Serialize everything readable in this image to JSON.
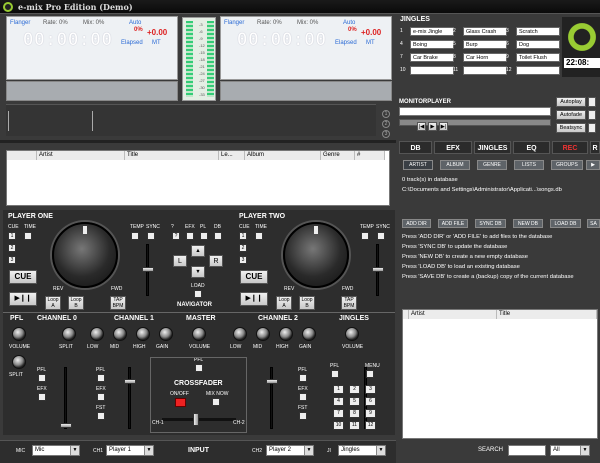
{
  "window": {
    "title": "e-mix Pro Edition (Demo)"
  },
  "deck1": {
    "flanger": "Flanger",
    "flanger_val": "Rate: 0%",
    "mix": "Mix: 0%",
    "auto": "Auto",
    "pitch": "+0.00",
    "bpm_pct": "0%",
    "elapsed": "Elapsed",
    "mt": "MT",
    "time": "00:00:00"
  },
  "deck2": {
    "flanger": "Flanger",
    "flanger_val": "Rate: 0%",
    "mix": "Mix: 0%",
    "auto": "Auto",
    "pitch": "+0.00",
    "bpm_pct": "0%",
    "elapsed": "Elapsed",
    "mt": "MT",
    "time": "00:00:00"
  },
  "meter": {
    "scale": [
      "-3",
      "-6",
      "-9",
      "-12",
      "-15",
      "-18",
      "-21",
      "-24",
      "-27",
      "-30",
      "-33"
    ]
  },
  "jingles": {
    "title": "JINGLES",
    "items": [
      {
        "n": "1",
        "label": "e-mix Jingle"
      },
      {
        "n": "2",
        "label": "Glass Crash"
      },
      {
        "n": "3",
        "label": "Scratch"
      },
      {
        "n": "4",
        "label": "Boing"
      },
      {
        "n": "5",
        "label": "Burp"
      },
      {
        "n": "6",
        "label": "Dog"
      },
      {
        "n": "7",
        "label": "Car Brake"
      },
      {
        "n": "8",
        "label": "Car Horn"
      },
      {
        "n": "9",
        "label": "Toilet Flush"
      },
      {
        "n": "10",
        "label": ""
      },
      {
        "n": "11",
        "label": ""
      },
      {
        "n": "12",
        "label": ""
      }
    ]
  },
  "clock": "22:08:",
  "monitor": {
    "title": "MONITORPLAYER"
  },
  "auto": {
    "autoplay": "Autoplay",
    "autofade": "Autofade",
    "beatsync": "Beatsync"
  },
  "playlist": {
    "columns": [
      "",
      "Artist",
      "Title",
      "Le...",
      "Album",
      "Genre",
      "#"
    ]
  },
  "tabs": {
    "db": "DB",
    "efx": "EFX",
    "jingles": "JINGLES",
    "eq": "EQ",
    "rec": "REC",
    "more": "R"
  },
  "db_buttons": {
    "artist": "ARTIST",
    "album": "ALBUM",
    "genre": "GENRE",
    "lists": "LISTS",
    "groups": "GROUPS"
  },
  "db_info": {
    "count": "0 track(s) in database",
    "path": "C:\\Documents and Settings\\Administrator\\Applicati...\\songs.db"
  },
  "db_actions": {
    "add_dir": "ADD DIR",
    "add_file": "ADD FILE",
    "sync_db": "SYNC DB",
    "new_db": "NEW DB",
    "load_db": "LOAD DB",
    "save": "SA"
  },
  "db_help": [
    "Press 'ADD DIR' or 'ADD FILE' to add files to the database",
    "Press 'SYNC DB' to update the database",
    "Press 'NEW DB' to create a new empty database",
    "Press 'LOAD DB' to load an existing database",
    "Press 'SAVE DB' to create a (backup) copy of the current database"
  ],
  "results": {
    "columns": [
      "Artist",
      "Title"
    ]
  },
  "search": {
    "label": "SEARCH",
    "value": "",
    "filter": "All"
  },
  "player_one": {
    "title": "PLAYER ONE",
    "cue": "CUE",
    "time": "TIME",
    "temp": "TEMP",
    "sync": "SYNC",
    "rev": "REV",
    "fwd": "FWD",
    "loop_a": "Loop A",
    "loop_b": "Loop B",
    "tap": "TAP BPM",
    "cue_btn": "CUE",
    "play": "▶❙❙",
    "n1": "1",
    "n2": "2",
    "n3": "3"
  },
  "player_two": {
    "title": "PLAYER TWO",
    "cue": "CUE",
    "time": "TIME",
    "temp": "TEMP",
    "sync": "SYNC",
    "rev": "REV",
    "fwd": "FWD",
    "loop_a": "Loop A",
    "loop_b": "Loop B",
    "tap": "TAP BPM",
    "cue_btn": "CUE",
    "play": "▶❙❙",
    "n1": "1",
    "n2": "2",
    "n3": "3"
  },
  "navigator": {
    "title": "NAVIGATOR",
    "q": "?",
    "efx": "EFX",
    "pl": "PL",
    "db": "DB",
    "l": "L",
    "r": "R",
    "load": "LOAD",
    "up": "▲",
    "down": "▼"
  },
  "mixer": {
    "pfl": "PFL",
    "ch0": "CHANNEL 0",
    "ch1": "CHANNEL 1",
    "master": "MASTER",
    "ch2": "CHANNEL 2",
    "jingles": "JINGLES",
    "volume": "VOLUME",
    "split": "SPLIT",
    "low": "LOW",
    "mid": "MID",
    "high": "HIGH",
    "gain": "GAIN",
    "efx": "EFX",
    "fst": "FST",
    "menu": "MENU",
    "crossfader": "CROSSFADER",
    "onoff": "ON/OFF",
    "mixnow": "MIX NOW",
    "ch1l": "CH-1",
    "ch2l": "CH-2",
    "pad": [
      "1",
      "2",
      "3",
      "4",
      "5",
      "6",
      "7",
      "8",
      "9",
      "10",
      "11",
      "12"
    ]
  },
  "input": {
    "title": "INPUT",
    "mic": "MIC",
    "mic_val": "Mic",
    "ch1": "CH1",
    "ch1_val": "Player 1",
    "ch2": "CH2",
    "ch2_val": "Player 2",
    "ji": "JI",
    "ji_val": "Jingles"
  }
}
